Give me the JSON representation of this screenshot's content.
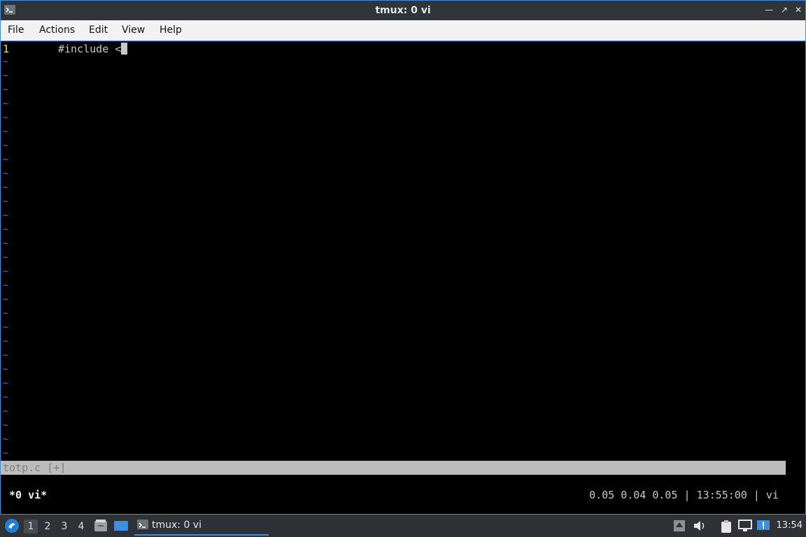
{
  "window": {
    "title": "tmux: 0 vi",
    "controls": [
      "minimize",
      "restore",
      "maximize",
      "close"
    ]
  },
  "menu": {
    "items": [
      "File",
      "Actions",
      "Edit",
      "View",
      "Help"
    ]
  },
  "editor": {
    "line_number": "1",
    "line_text": "#include <",
    "tilde": "~",
    "status_file": "totp.c [+]"
  },
  "tmux": {
    "window_label": "*0 vi*",
    "right_status": "0.05 0.04 0.05 | 13:55:00 | vi"
  },
  "taskbar": {
    "workspaces": [
      "1",
      "2",
      "3",
      "4"
    ],
    "active_workspace": "1",
    "task_label": "tmux: 0 vi",
    "clock": "13:54"
  },
  "colors": {
    "accent": "#3c8fe0",
    "line_number": "#e5e52e",
    "tilde": "#4a6fe8"
  }
}
